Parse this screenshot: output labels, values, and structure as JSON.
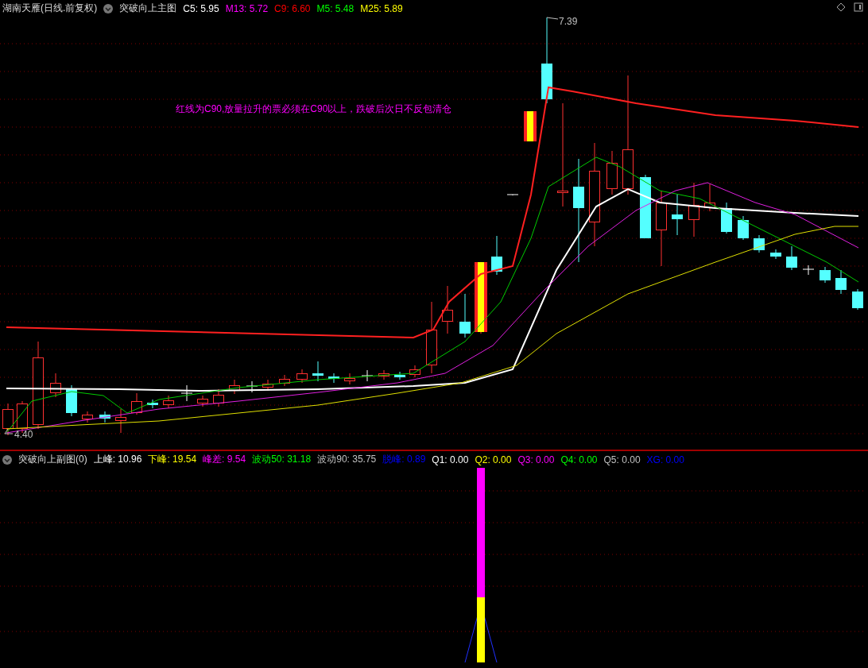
{
  "main_panel": {
    "stock_title": "湖南天雁(日线.前复权)",
    "indicator_name": "突破向上主图",
    "readouts": [
      {
        "label": "C5:",
        "value": "5.95",
        "color": "#ffffff"
      },
      {
        "label": "M13:",
        "value": "5.72",
        "color": "#ff00ff"
      },
      {
        "label": "C9:",
        "value": "6.60",
        "color": "#ff0000"
      },
      {
        "label": "M5:",
        "value": "5.48",
        "color": "#00ff00"
      },
      {
        "label": "M25:",
        "value": "5.89",
        "color": "#ffff00"
      }
    ],
    "note": "红线为C90,放量拉升的票必须在C90以上，跌破后次日不反包清仓",
    "high_label": "7.39",
    "low_label": "4.40"
  },
  "sub_panel": {
    "indicator_name": "突破向上副图(0)",
    "readouts": [
      {
        "label": "上峰:",
        "value": "10.96",
        "color": "#ffffff"
      },
      {
        "label": "下峰:",
        "value": "19.54",
        "color": "#ffff00"
      },
      {
        "label": "峰差:",
        "value": "9.54",
        "color": "#ff00ff"
      },
      {
        "label": "波动50:",
        "value": "31.18",
        "color": "#00ff00"
      },
      {
        "label": "波动90:",
        "value": "35.75",
        "color": "#c0c0c0"
      },
      {
        "label": "脱峰:",
        "value": "0.89",
        "color": "#0000ff"
      },
      {
        "label": "Q1:",
        "value": "0.00",
        "color": "#ffffff"
      },
      {
        "label": "Q2:",
        "value": "0.00",
        "color": "#ffff00"
      },
      {
        "label": "Q3:",
        "value": "0.00",
        "color": "#ff00ff"
      },
      {
        "label": "Q4:",
        "value": "0.00",
        "color": "#00ff00"
      },
      {
        "label": "Q5:",
        "value": "0.00",
        "color": "#c0c0c0"
      },
      {
        "label": "XG:",
        "value": "0.00",
        "color": "#0000ff"
      }
    ]
  }
}
